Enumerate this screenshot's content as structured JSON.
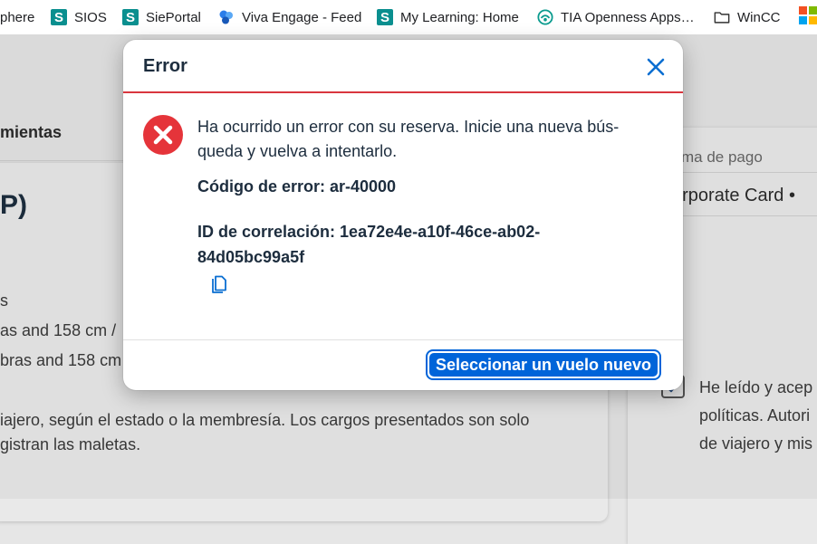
{
  "bookmarks": [
    {
      "label": "phere",
      "icon": "none"
    },
    {
      "label": "SIOS",
      "icon": "sios-icon"
    },
    {
      "label": "SiePortal",
      "icon": "sieportal-icon"
    },
    {
      "label": "Viva Engage - Feed",
      "icon": "viva-engage-icon"
    },
    {
      "label": "My Learning: Home",
      "icon": "my-learning-icon"
    },
    {
      "label": "TIA Openness Apps…",
      "icon": "tia-icon"
    },
    {
      "label": "WinCC",
      "icon": "folder-icon"
    }
  ],
  "background": {
    "tab_label": "mientas",
    "heading": "P)",
    "line1": "s",
    "line2": "as and 158 cm /",
    "line3": "bras and 158 cm",
    "line4": "iajero, según el estado o la membresía. Los cargos presentados son solo",
    "line5": "gistran las maletas.",
    "right_small": "ma de pago",
    "right_card_value": "orporate Card •",
    "terms_line1": "He leído y acep",
    "terms_line2": "políticas. Autori",
    "terms_line3": "de viajero y mis"
  },
  "dialog": {
    "title": "Error",
    "message": "Ha ocurrido un error con su reserva. Inicie una nueva bús-queda y vuelva a intentarlo.",
    "error_code": "Código de error: ar-40000",
    "correlation_id": "ID de correlación: 1ea72e4e-a10f-46ce-ab02-84d05bc99a5f",
    "primary_button": "Seleccionar un vuelo nuevo"
  },
  "colors": {
    "accent": "#0064d9",
    "error": "#e5343a",
    "header_border": "#d9363e"
  }
}
